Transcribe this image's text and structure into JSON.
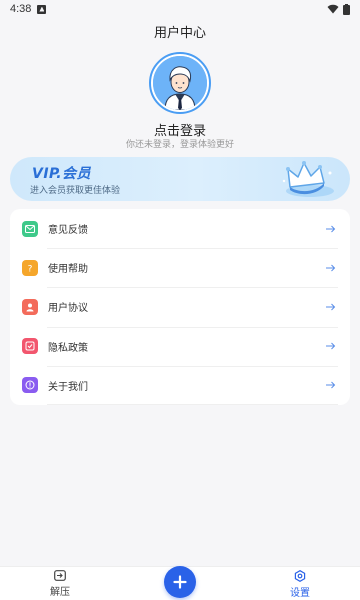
{
  "status": {
    "time": "4:38"
  },
  "header": {
    "title": "用户中心"
  },
  "profile": {
    "login_title": "点击登录",
    "login_subtitle": "你还未登录，登录体验更好"
  },
  "vip": {
    "title": "VIP.会员",
    "subtitle": "进入会员获取更佳体验"
  },
  "menu": {
    "items": [
      {
        "label": "意见反馈",
        "icon": "feedback-icon",
        "color": "#3ec98a"
      },
      {
        "label": "使用帮助",
        "icon": "help-icon",
        "color": "#f5a62b"
      },
      {
        "label": "用户协议",
        "icon": "user-agreement-icon",
        "color": "#f36b5b"
      },
      {
        "label": "隐私政策",
        "icon": "privacy-icon",
        "color": "#f2566e"
      },
      {
        "label": "关于我们",
        "icon": "about-icon",
        "color": "#8a5cf0"
      }
    ]
  },
  "tabbar": {
    "left": {
      "label": "解压"
    },
    "right": {
      "label": "设置"
    },
    "accent": "#2a62e8"
  }
}
